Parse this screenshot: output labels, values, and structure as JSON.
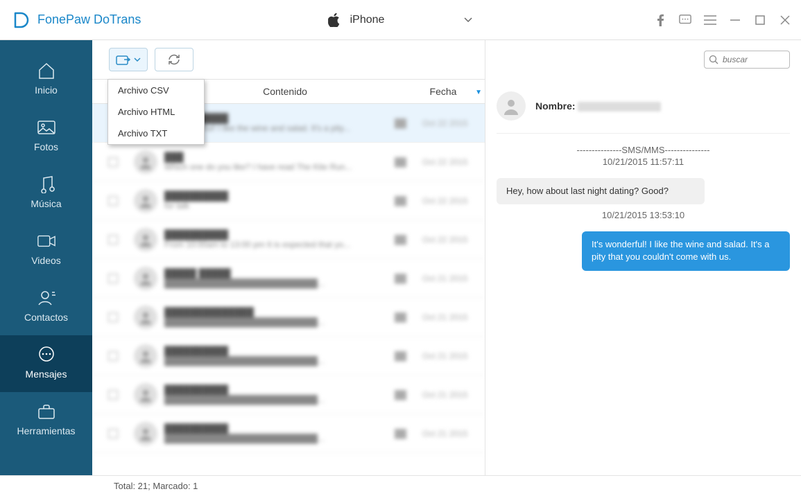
{
  "app": {
    "title": "FonePaw DoTrans"
  },
  "device": {
    "name": "iPhone"
  },
  "search": {
    "placeholder": "buscar"
  },
  "sidebar": {
    "items": [
      {
        "label": "Inicio"
      },
      {
        "label": "Fotos"
      },
      {
        "label": "Música"
      },
      {
        "label": "Videos"
      },
      {
        "label": "Contactos"
      },
      {
        "label": "Mensajes"
      },
      {
        "label": "Herramientas"
      }
    ]
  },
  "export_menu": {
    "items": [
      {
        "label": "Archivo CSV"
      },
      {
        "label": "Archivo HTML"
      },
      {
        "label": "Archivo TXT"
      }
    ]
  },
  "columns": {
    "content": "Contenido",
    "date": "Fecha"
  },
  "footer": {
    "text": "Total: 21; Marcado: 1"
  },
  "contact": {
    "name_label": "Nombre:"
  },
  "conversation": {
    "divider": "---------------SMS/MMS---------------",
    "ts1": "10/21/2015 11:57:11",
    "msg_in": "Hey, how about last night dating? Good?",
    "ts2": "10/21/2015 13:53:10",
    "msg_out": "It's wonderful! I like the wine and salad. It's a pity that you couldn't come with us."
  },
  "icon_names": {
    "logo": "app-logo-icon",
    "apple": "apple-icon",
    "chevron_down": "chevron-down-icon",
    "facebook": "facebook-icon",
    "feedback": "feedback-icon",
    "menu": "menu-icon",
    "minimize": "minimize-icon",
    "maximize": "maximize-icon",
    "close": "close-icon",
    "home": "home-icon",
    "photos": "photos-icon",
    "music": "music-icon",
    "videos": "videos-icon",
    "contacts": "contacts-icon",
    "messages": "messages-icon",
    "tools": "tools-icon",
    "export": "export-icon",
    "refresh": "refresh-icon",
    "search": "search-icon",
    "user": "user-icon",
    "battery": "battery-icon"
  }
}
